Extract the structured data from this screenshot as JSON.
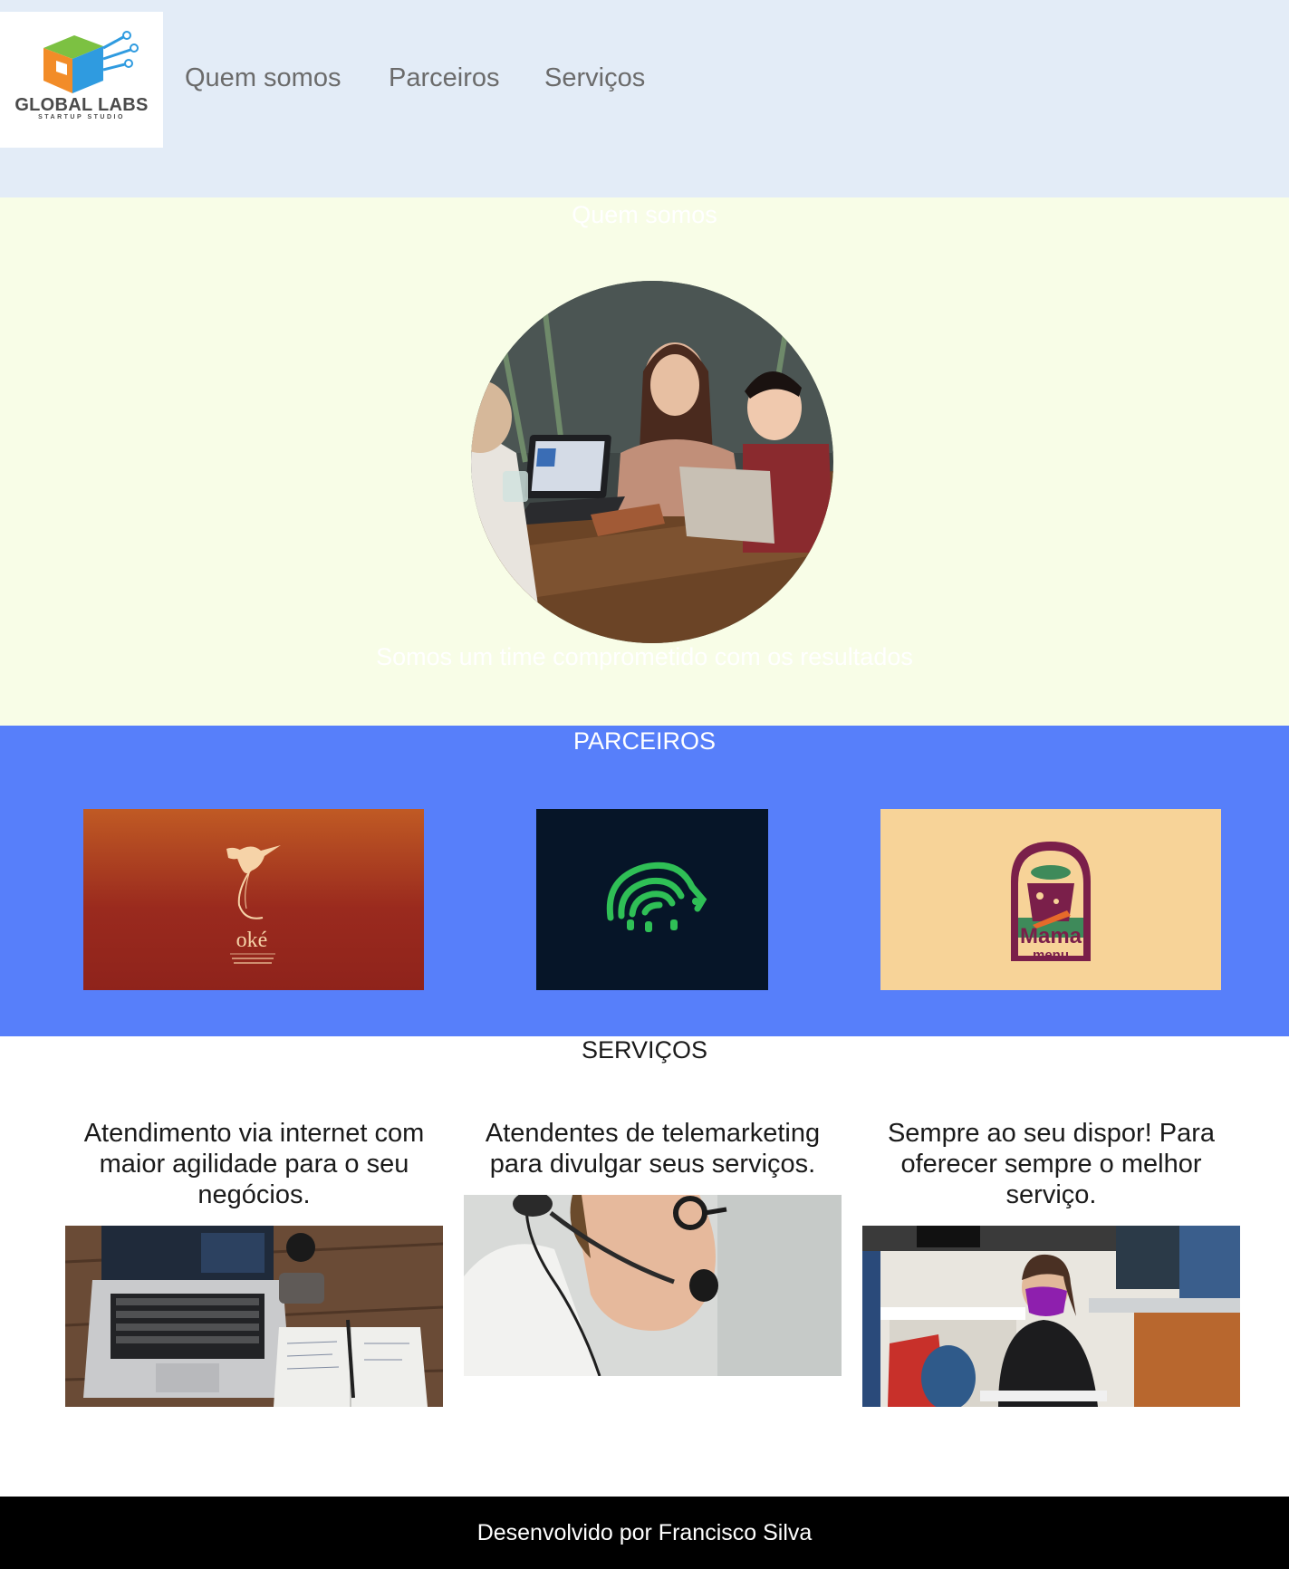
{
  "header": {
    "logo": {
      "name": "GLOBAL LABS",
      "tagline": "STARTUP STUDIO"
    },
    "nav": [
      {
        "label": "Quem somos"
      },
      {
        "label": "Parceiros"
      },
      {
        "label": "Serviços"
      }
    ]
  },
  "about": {
    "title": "Quem somos",
    "photo_icon": "team-meeting-photo",
    "text": "Somos um time comprometido com os resultados"
  },
  "partners": {
    "title": "PARCEIROS",
    "items": [
      {
        "icon": "hummingbird-logo",
        "brand": "oké",
        "bg": "#a83a1c"
      },
      {
        "icon": "hedgehog-logo",
        "bg": "#061528"
      },
      {
        "icon": "mama-menu-logo",
        "brand": "Mama",
        "sub": "menu",
        "bg": "#f7d398"
      }
    ]
  },
  "services": {
    "title": "SERVIÇOS",
    "items": [
      {
        "text": "Atendimento via internet com maior agilidade para o seu negócios.",
        "icon": "laptop-desk-photo"
      },
      {
        "text": "Atendentes de telemarketing para divulgar seus serviços.",
        "icon": "headset-agent-photo"
      },
      {
        "text": "Sempre ao seu dispor! Para oferecer sempre o melhor serviço.",
        "icon": "masked-worker-photo"
      }
    ]
  },
  "footer": {
    "text": "Desenvolvido por Francisco Silva"
  },
  "colors": {
    "header_bg": "#e3ecf7",
    "about_bg": "#f8fde7",
    "partners_bg": "#577ffa",
    "footer_bg": "#000000"
  }
}
